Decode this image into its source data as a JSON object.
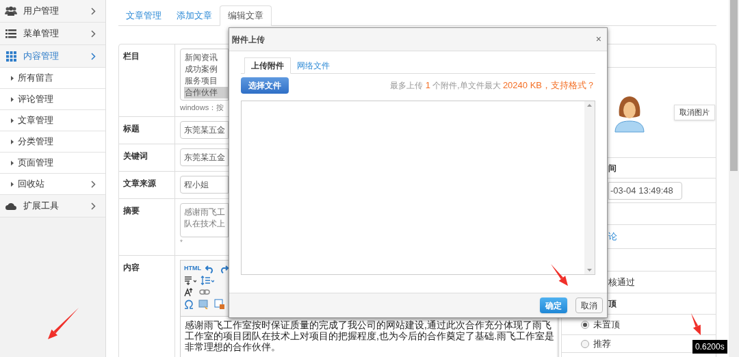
{
  "sidebar": {
    "items": [
      {
        "label": "用户管理",
        "expanded": false
      },
      {
        "label": "菜单管理",
        "expanded": false
      },
      {
        "label": "内容管理",
        "expanded": true,
        "children": [
          {
            "label": "所有留言",
            "has_arrow": false
          },
          {
            "label": "评论管理",
            "has_arrow": false
          },
          {
            "label": "文章管理",
            "has_arrow": false
          },
          {
            "label": "分类管理",
            "has_arrow": false
          },
          {
            "label": "页面管理",
            "has_arrow": false
          },
          {
            "label": "回收站",
            "has_arrow": true
          }
        ]
      },
      {
        "label": "扩展工具",
        "expanded": false
      }
    ]
  },
  "tabs": [
    {
      "label": "文章管理",
      "selected": false
    },
    {
      "label": "添加文章",
      "selected": false
    },
    {
      "label": "编辑文章",
      "selected": true
    }
  ],
  "form": {
    "rows": [
      {
        "label": "栏目",
        "kind": "select",
        "options": [
          {
            "label": "新闻资讯",
            "selected": false
          },
          {
            "label": "成功案例",
            "selected": false
          },
          {
            "label": "服务项目",
            "selected": false
          },
          {
            "label": "合作伙伴",
            "selected": true
          }
        ],
        "hint": "windows：按"
      },
      {
        "label": "标题",
        "kind": "input",
        "value": "东莞某五金"
      },
      {
        "label": "关键词",
        "kind": "input",
        "value": "东莞某五金"
      },
      {
        "label": "文章来源",
        "kind": "input",
        "value": "程小姐"
      },
      {
        "label": "摘要",
        "kind": "textarea",
        "lines": [
          "感谢雨飞工",
          "队在技术上"
        ],
        "note": "*"
      },
      {
        "label": "内容",
        "kind": "editor",
        "source_button": "HTML",
        "text": "感谢雨飞工作室按时保证质量的完成了我公司的网站建设,通过此次合作充分体现了雨飞工作室的项目团队在技术上对项目的把握程度,也为今后的合作奠定了基础.雨飞工作室是非常理想的合作伙伴。"
      }
    ]
  },
  "side_panel": {
    "cancel_image_button": "取消图片",
    "rows": [
      {
        "kind": "label",
        "text": "间"
      },
      {
        "kind": "field",
        "text": "-03-04 13:49:48"
      },
      {
        "kind": "empty"
      },
      {
        "kind": "link",
        "text": "论"
      },
      {
        "kind": "empty"
      },
      {
        "kind": "text",
        "text": "核通过"
      },
      {
        "kind": "label",
        "text": "顶"
      },
      {
        "kind": "radio",
        "text": "未置顶",
        "selected": true
      },
      {
        "kind": "radio",
        "text": "推荐",
        "selected": false
      }
    ]
  },
  "dialog": {
    "title": "附件上传",
    "close": "×",
    "tabs": [
      {
        "label": "上传附件",
        "selected": true
      },
      {
        "label": "网络文件",
        "selected": false
      }
    ],
    "choose_button": "选择文件",
    "hint_parts": [
      {
        "text": "最多上传 ",
        "highlight": false
      },
      {
        "text": "1",
        "highlight": true
      },
      {
        "text": " 个附件,单文件最大 ",
        "highlight": false
      },
      {
        "text": "20240 KB，支持格式？",
        "highlight": true
      }
    ],
    "ok_button": "确定",
    "cancel_button": "取消"
  },
  "trace_time": "0.6200s",
  "annotations": [
    {
      "kind": "arrow"
    },
    {
      "kind": "arrow"
    },
    {
      "kind": "arrow"
    }
  ]
}
